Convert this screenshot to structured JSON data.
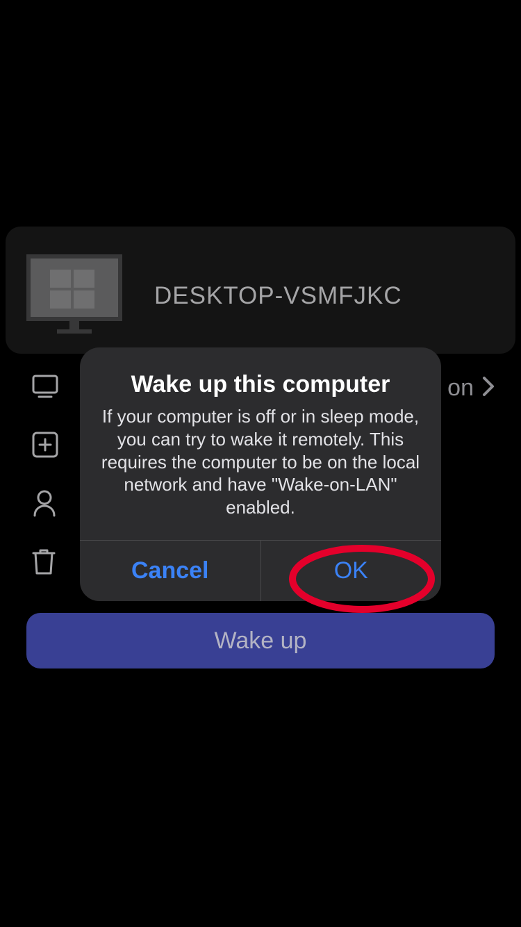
{
  "header": {
    "computer_name": "DESKTOP-VSMFJKC"
  },
  "options": {
    "row1_trailing": "on"
  },
  "wake_button_label": "Wake up",
  "dialog": {
    "title": "Wake up this computer",
    "message": "If your computer is off or in sleep mode, you can try to wake it remotely. This requires the computer to be on the local network and have \"Wake-on-LAN\" enabled.",
    "cancel_label": "Cancel",
    "ok_label": "OK"
  },
  "colors": {
    "accent_blue": "#3b82f6",
    "button_bg": "#394094",
    "annotation_red": "#e4002b"
  }
}
